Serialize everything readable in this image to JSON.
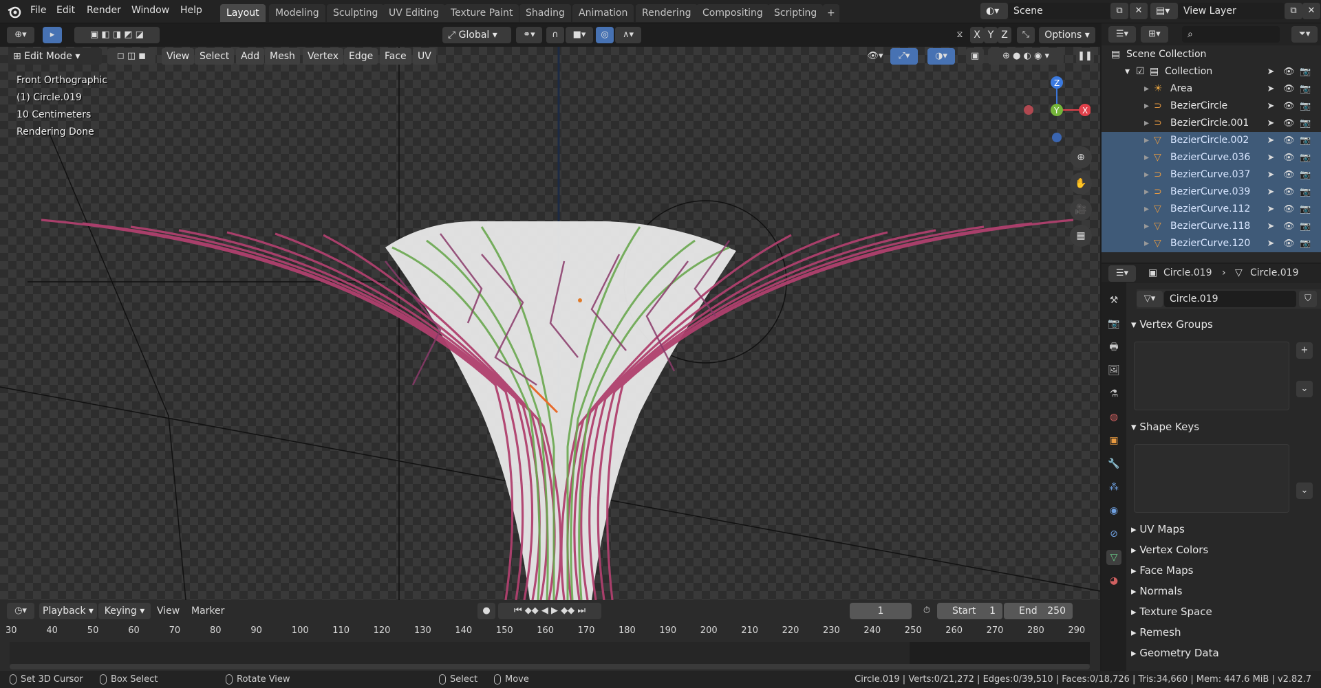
{
  "top_menu": [
    "File",
    "Edit",
    "Render",
    "Window",
    "Help"
  ],
  "workspaces": [
    "Layout",
    "Modeling",
    "Sculpting",
    "UV Editing",
    "Texture Paint",
    "Shading",
    "Animation",
    "Rendering",
    "Compositing",
    "Scripting"
  ],
  "active_workspace": "Layout",
  "scene_name": "Scene",
  "view_layer": "View Layer",
  "toolbar": {
    "transform_orientation": "Global",
    "axes": [
      "X",
      "Y",
      "Z"
    ],
    "options_label": "Options"
  },
  "viewport": {
    "mode": "Edit Mode",
    "menus": [
      "View",
      "Select",
      "Add",
      "Mesh",
      "Vertex",
      "Edge",
      "Face",
      "UV"
    ],
    "info": [
      "Front Orthographic",
      "(1) Circle.019",
      "10 Centimeters",
      "Rendering Done"
    ],
    "gizmo": {
      "z": "Z",
      "y": "Y",
      "x": "X"
    }
  },
  "outliner": {
    "root": "Scene Collection",
    "collection": "Collection",
    "items": [
      {
        "name": "Area",
        "selected": false,
        "icon": "light-icon"
      },
      {
        "name": "BezierCircle",
        "selected": false,
        "icon": "curve-icon"
      },
      {
        "name": "BezierCircle.001",
        "selected": false,
        "icon": "curve-icon"
      },
      {
        "name": "BezierCircle.002",
        "selected": true,
        "icon": "mesh-icon"
      },
      {
        "name": "BezierCurve.036",
        "selected": true,
        "icon": "mesh-icon"
      },
      {
        "name": "BezierCurve.037",
        "selected": true,
        "icon": "curve-icon"
      },
      {
        "name": "BezierCurve.039",
        "selected": true,
        "icon": "curve-icon"
      },
      {
        "name": "BezierCurve.112",
        "selected": true,
        "icon": "mesh-icon"
      },
      {
        "name": "BezierCurve.118",
        "selected": true,
        "icon": "mesh-icon"
      },
      {
        "name": "BezierCurve.120",
        "selected": true,
        "icon": "mesh-icon"
      }
    ]
  },
  "properties": {
    "breadcrumb_object": "Circle.019",
    "breadcrumb_data": "Circle.019",
    "datablock_name": "Circle.019",
    "panels_open": [
      "Vertex Groups",
      "Shape Keys"
    ],
    "panels_closed": [
      "UV Maps",
      "Vertex Colors",
      "Face Maps",
      "Normals",
      "Texture Space",
      "Remesh",
      "Geometry Data"
    ]
  },
  "timeline": {
    "menus": [
      "Playback",
      "Keying",
      "View",
      "Marker"
    ],
    "current_frame": "1",
    "start_label": "Start",
    "start": "1",
    "end_label": "End",
    "end": "250",
    "ticks": [
      "30",
      "40",
      "50",
      "60",
      "70",
      "80",
      "90",
      "100",
      "110",
      "120",
      "130",
      "140",
      "150",
      "160",
      "170",
      "180",
      "190",
      "200",
      "210",
      "220",
      "230",
      "240",
      "250",
      "260",
      "270",
      "280",
      "290"
    ]
  },
  "statusbar": {
    "left": [
      "Set 3D Cursor",
      "Box Select",
      "Rotate View",
      "Select",
      "Move"
    ],
    "stats": "Circle.019 | Verts:0/21,272 | Edges:0/39,510 | Faces:0/18,726 | Tris:34,660 | Mem: 447.6 MiB | v2.82.7"
  },
  "colors": {
    "selected_row": "#3f5a78",
    "active_tab": "#494949",
    "curve_pink": "#b0406e",
    "curve_green": "#6aa84f"
  }
}
